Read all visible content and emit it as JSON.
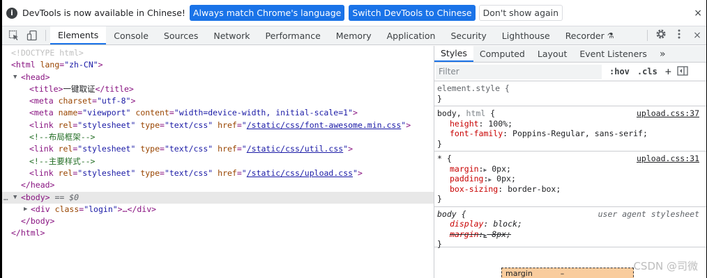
{
  "infobar": {
    "icon": "i",
    "message": "DevTools is now available in Chinese!",
    "btn_match": "Always match Chrome's language",
    "btn_switch": "Switch DevTools to Chinese",
    "btn_dismiss": "Don't show again",
    "close": "×"
  },
  "toolbar": {
    "tabs": [
      "Elements",
      "Console",
      "Sources",
      "Network",
      "Performance",
      "Memory",
      "Application",
      "Security",
      "Lighthouse",
      "Recorder"
    ],
    "recorder_badge": "⚗",
    "close": "×"
  },
  "dom": {
    "doctype": "<!DOCTYPE html>",
    "html_open": "<html",
    "html_attr_name": "lang",
    "html_attr_val": "\"zh-CN\"",
    "html_close_bracket": ">",
    "head_open": "<head>",
    "title_open": "<title>",
    "title_text": "一键取证",
    "title_close": "</title>",
    "meta1_open": "<meta",
    "meta1_an": "charset",
    "meta1_av": "\"utf-8\"",
    "meta2_an1": "name",
    "meta2_av1": "\"viewport\"",
    "meta2_an2": "content",
    "meta2_av2": "\"width=device-width, initial-scale=1\"",
    "link_open": "<link",
    "rel": "rel",
    "rel_val": "\"stylesheet\"",
    "type": "type",
    "type_val": "\"text/css\"",
    "href": "href",
    "href1": "/static/css/font-awesome.min.css",
    "href2": "/static/css/util.css",
    "href3": "/static/css/upload.css",
    "quote": "\"",
    "comment1": "<!--布局框架-->",
    "comment2": "<!--主要样式-->",
    "head_close": "</head>",
    "body_open": "<body>",
    "body_eq": "== $0",
    "div_open": "<div",
    "div_an": "class",
    "div_av": "\"login\"",
    "div_rest": ">…</div>",
    "body_close": "</body>",
    "html_close": "</html>",
    "gt": ">",
    "dots": "…"
  },
  "styles": {
    "tabs": [
      "Styles",
      "Computed",
      "Layout",
      "Event Listeners"
    ],
    "more": "»",
    "filter_placeholder": "Filter",
    "hov": ":hov",
    "cls": ".cls",
    "plus": "+",
    "rules": {
      "element_style": "element.style {",
      "close_brace": "}",
      "r1_selector_a": "body,",
      "r1_selector_b": " html",
      "r1_open": " {",
      "r1_src": "upload.css:37",
      "r1_p1": "height",
      "r1_v1": "100%;",
      "r1_p2": "font-family",
      "r1_v2": "Poppins-Regular, sans-serif;",
      "r2_selector": "* {",
      "r2_src": "upload.css:31",
      "r2_p1": "margin",
      "r2_v1": "0px;",
      "r2_p2": "padding",
      "r2_v2": "0px;",
      "r2_p3": "box-sizing",
      "r2_v3": "border-box;",
      "r3_selector": "body {",
      "r3_src": "user agent stylesheet",
      "r3_p1": "display",
      "r3_v1": "block;",
      "r3_p2": "margin",
      "r3_v2": "8px;",
      "colon": ": ",
      "colon_tri": ":",
      "tri": "▶"
    },
    "box_margin_label": "margin",
    "box_margin_value": "–"
  },
  "watermark": "CSDN @司微",
  "colors": {
    "accent": "#1a73e8",
    "tag": "#881280",
    "attr_name": "#994500",
    "attr_value": "#1a1aa6",
    "comment": "#236e25",
    "property": "#c80000"
  }
}
